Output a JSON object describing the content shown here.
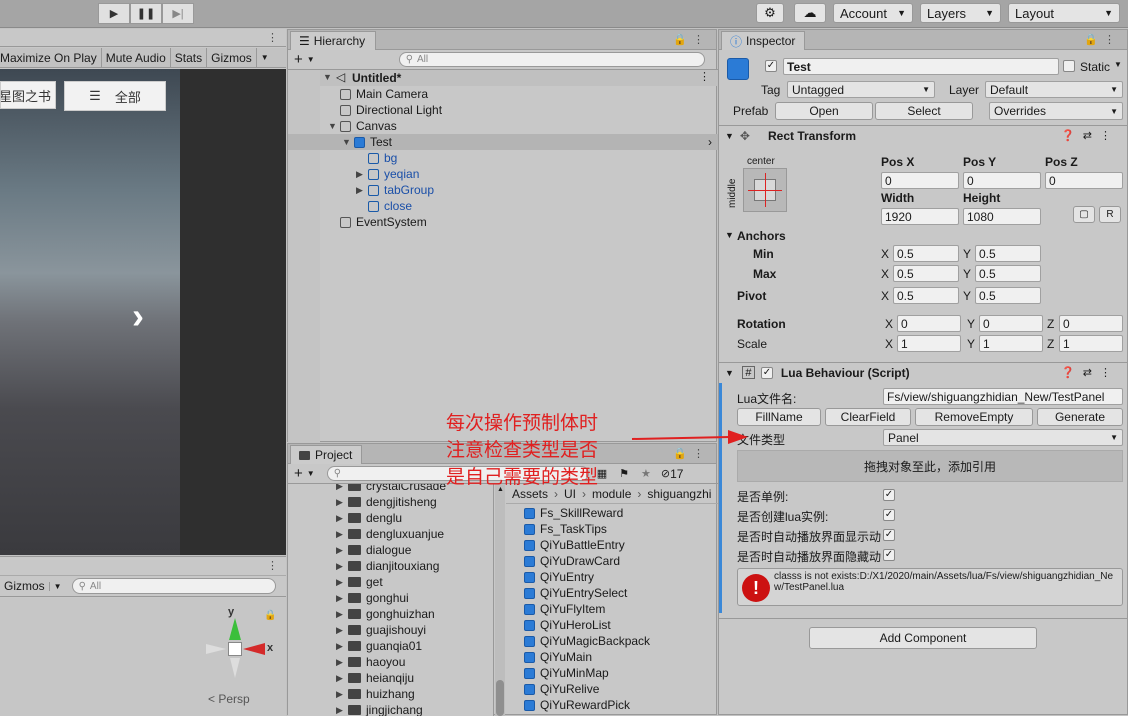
{
  "toolbar": {
    "play_icon": "play-icon",
    "pause_icon": "pause-icon",
    "step_icon": "step-icon",
    "collab_icon": "collab-icon",
    "cloud_icon": "cloud-icon",
    "account": "Account",
    "layers": "Layers",
    "layout": "Layout"
  },
  "game": {
    "menu": [
      "Maximize On Play",
      "Mute Audio",
      "Stats",
      "Gizmos"
    ],
    "left_btn": "星图之书",
    "all_btn": "全部"
  },
  "scene": {
    "gizmos": "Gizmos",
    "search_placeholder": "All",
    "persp": "< Persp",
    "axis_y": "y",
    "axis_x": "x"
  },
  "hierarchy": {
    "tab": "Hierarchy",
    "search_placeholder": "All",
    "root": "Untitled*",
    "items": [
      {
        "label": "Main Camera",
        "depth": 1
      },
      {
        "label": "Directional Light",
        "depth": 1
      },
      {
        "label": "Canvas",
        "depth": 1
      },
      {
        "label": "Test",
        "depth": 2
      },
      {
        "label": "bg",
        "depth": 3
      },
      {
        "label": "yeqian",
        "depth": 3
      },
      {
        "label": "tabGroup",
        "depth": 3
      },
      {
        "label": "close",
        "depth": 3
      },
      {
        "label": "EventSystem",
        "depth": 1
      }
    ]
  },
  "project": {
    "tab": "Project",
    "hidden_count": "17",
    "folders": [
      "crystalCrusade",
      "dengjitisheng",
      "denglu",
      "dengluxuanjue",
      "dialogue",
      "dianjitouxiang",
      "get",
      "gonghui",
      "gonghuizhan",
      "guajishouyi",
      "guanqia01",
      "haoyou",
      "heianqiju",
      "huizhang",
      "jingjichang"
    ],
    "breadcrumb": [
      "Assets",
      "UI",
      "module",
      "shiguangzhi"
    ],
    "assets": [
      "Fs_SkillReward",
      "Fs_TaskTips",
      "QiYuBattleEntry",
      "QiYuDrawCard",
      "QiYuEntry",
      "QiYuEntrySelect",
      "QiYuFlyItem",
      "QiYuHeroList",
      "QiYuMagicBackpack",
      "QiYuMain",
      "QiYuMinMap",
      "QiYuRelive",
      "QiYuRewardPick"
    ]
  },
  "inspector": {
    "tab": "Inspector",
    "name": "Test",
    "static": "Static",
    "tag_label": "Tag",
    "tag": "Untagged",
    "layer_label": "Layer",
    "layer": "Default",
    "prefab_label": "Prefab",
    "open": "Open",
    "select": "Select",
    "overrides": "Overrides",
    "rect": {
      "title": "Rect Transform",
      "anchor_h": "center",
      "anchor_v": "middle",
      "pos_labels": [
        "Pos X",
        "Pos Y",
        "Pos Z"
      ],
      "pos": [
        "0",
        "0",
        "0"
      ],
      "width_label": "Width",
      "height_label": "Height",
      "width": "1920",
      "height": "1080",
      "r_btn": "R",
      "anchors": "Anchors",
      "min": "Min",
      "max": "Max",
      "min_x": "0.5",
      "min_y": "0.5",
      "max_x": "0.5",
      "max_y": "0.5",
      "pivot": "Pivot",
      "pivot_x": "0.5",
      "pivot_y": "0.5",
      "rotation": "Rotation",
      "rot": [
        "0",
        "0",
        "0"
      ],
      "scale": "Scale",
      "scl": [
        "1",
        "1",
        "1"
      ],
      "x": "X",
      "y": "Y",
      "z": "Z"
    },
    "lua": {
      "title": "Lua Behaviour (Script)",
      "file_label": "Lua文件名:",
      "file": "Fs/view/shiguangzhidian_New/TestPanel",
      "buttons": [
        "FillName",
        "ClearField",
        "RemoveEmpty",
        "Generate"
      ],
      "type_label": "文件类型",
      "type": "Panel",
      "drop_hint": "拖拽对象至此，添加引用",
      "opts": [
        "是否单例:",
        "是否创建lua实例:",
        "是否时自动播放界面显示动",
        "是否时自动播放界面隐藏动"
      ],
      "error": "classs is not exists:D:/X1/2020/main/Assets/lua/Fs/view/shiguangzhidian_New/TestPanel.lua"
    },
    "add_component": "Add Component"
  },
  "annotation": {
    "lines": [
      "每次操作预制体时",
      "注意检查类型是否",
      "是自己需要的类型"
    ],
    "color": "#e02020"
  }
}
